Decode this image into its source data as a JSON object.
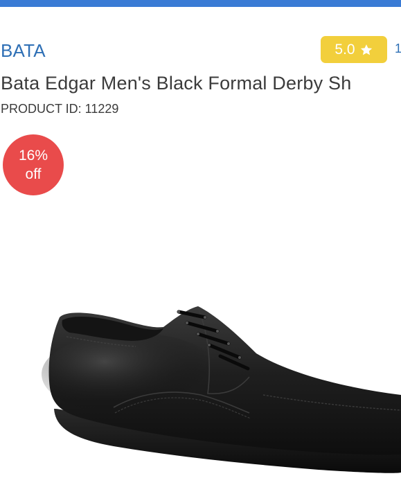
{
  "header": {
    "bar_color": "#3a7bd5"
  },
  "product": {
    "brand": "BATA",
    "rating": {
      "value": "5.0",
      "icon": "star-icon",
      "color": "#f2cf3c"
    },
    "review_count_partial": "1",
    "title": "Bata Edgar  Men's Black Formal Derby Sh",
    "product_id": "PRODUCT ID: 11229",
    "discount": {
      "percent": "16%",
      "suffix": "off",
      "color": "#e94b4b"
    },
    "image": {
      "icon": "black-derby-shoe"
    }
  }
}
